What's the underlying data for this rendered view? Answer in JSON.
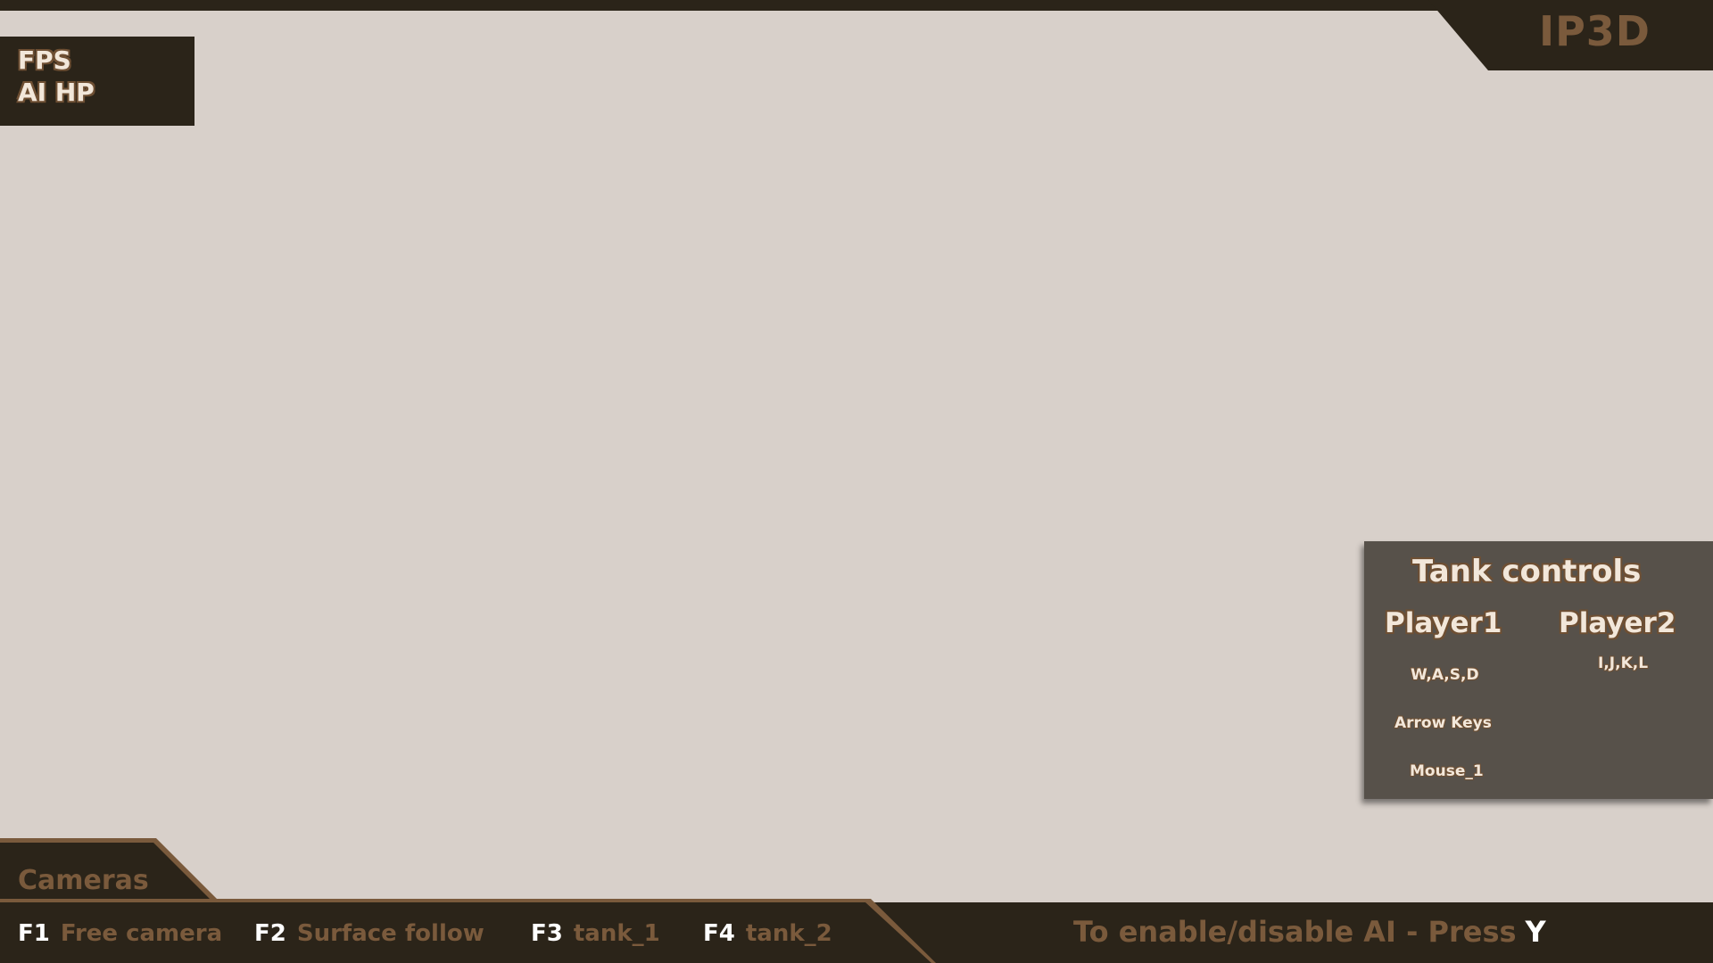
{
  "logo": {
    "text": "IP3D"
  },
  "stats": {
    "fps_label": "FPS",
    "ai_hp_label": "AI HP"
  },
  "tank_controls": {
    "title": "Tank controls",
    "player1": {
      "label": "Player1",
      "movement": "W,A,S,D",
      "aim": "Arrow Keys",
      "fire": "Mouse_1"
    },
    "player2": {
      "label": "Player2",
      "movement": "I,J,K,L"
    }
  },
  "cameras": {
    "title": "Cameras",
    "items": [
      {
        "key": "F1",
        "name": "Free camera"
      },
      {
        "key": "F2",
        "name": "Surface follow"
      },
      {
        "key": "F3",
        "name": "tank_1"
      },
      {
        "key": "F4",
        "name": "tank_2"
      }
    ]
  },
  "ai_toggle": {
    "text": "To enable/disable AI - Press",
    "key": "Y"
  },
  "colors": {
    "background": "#d8d0ca",
    "panel_dark": "#2b2419",
    "panel_gray": "#57514a",
    "accent": "#7a5a3c",
    "text_light": "#f2e7da"
  }
}
